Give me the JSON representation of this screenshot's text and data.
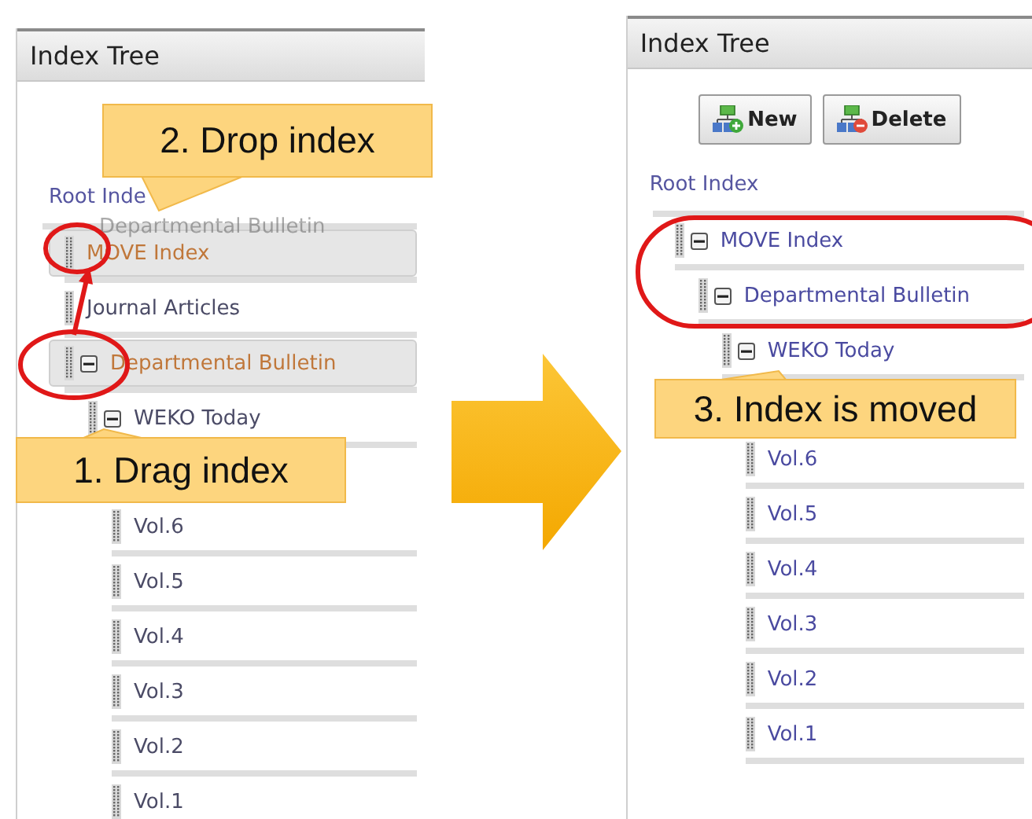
{
  "panels": [
    {
      "kind": "before",
      "title": "Index Tree",
      "root": "Root Inde",
      "drag_ghost": {
        "label": "Departmental Bulletin"
      },
      "items": [
        {
          "label": "MOVE Index",
          "highlighted": true
        },
        {
          "label": "Journal Articles",
          "highlighted": false
        },
        {
          "label": "Departmental Bulletin",
          "highlighted": true,
          "expanded": true,
          "children": [
            {
              "label": "WEKO Today",
              "highlighted": false,
              "expanded": true,
              "children": [
                {
                  "label": "Vol.6",
                  "highlighted": false
                },
                {
                  "label": "Vol.5",
                  "highlighted": false
                },
                {
                  "label": "Vol.4",
                  "highlighted": false
                },
                {
                  "label": "Vol.3",
                  "highlighted": false
                },
                {
                  "label": "Vol.2",
                  "highlighted": false
                },
                {
                  "label": "Vol.1",
                  "highlighted": false
                }
              ]
            }
          ]
        }
      ],
      "callouts": [
        {
          "text": "2. Drop index"
        },
        {
          "text": "1. Drag index"
        }
      ]
    },
    {
      "kind": "after",
      "title": "Index Tree",
      "root": "Root Index",
      "buttons": [
        {
          "label": "New",
          "kind": "new"
        },
        {
          "label": "Delete",
          "kind": "delete"
        }
      ],
      "items": [
        {
          "label": "MOVE Index",
          "highlighted": false,
          "expanded": true,
          "children": [
            {
              "label": "Departmental Bulletin",
              "highlighted": false,
              "expanded": true,
              "children": [
                {
                  "label": "WEKO Today",
                  "highlighted": false,
                  "expanded": true,
                  "children": [
                    {
                      "label": "Vol.6",
                      "highlighted": false
                    },
                    {
                      "label": "Vol.5",
                      "highlighted": false
                    },
                    {
                      "label": "Vol.4",
                      "highlighted": false
                    },
                    {
                      "label": "Vol.3",
                      "highlighted": false
                    },
                    {
                      "label": "Vol.2",
                      "highlighted": false
                    },
                    {
                      "label": "Vol.1",
                      "highlighted": false
                    }
                  ]
                }
              ]
            }
          ]
        }
      ],
      "callouts": [
        {
          "text": "3. Index is moved"
        }
      ]
    }
  ]
}
